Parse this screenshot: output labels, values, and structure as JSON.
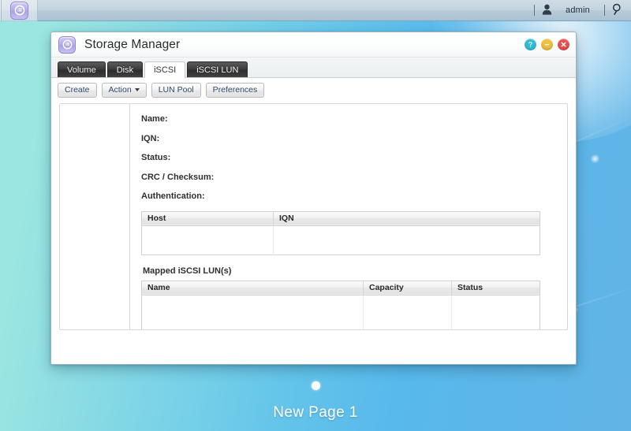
{
  "topbar": {
    "app_icon": "storage-manager-icon",
    "user_icon": "user-icon",
    "user_name": "admin",
    "search_icon": "search-icon"
  },
  "window": {
    "icon": "storage-manager-icon",
    "title": "Storage Manager",
    "controls": {
      "help_label": "?",
      "minimize_label": "–",
      "close_label": "✕"
    },
    "tabs": [
      {
        "label": "Volume",
        "active": false
      },
      {
        "label": "Disk",
        "active": false
      },
      {
        "label": "iSCSI",
        "active": true
      },
      {
        "label": "iSCSI LUN",
        "active": false
      }
    ],
    "toolbar": [
      {
        "label": "Create",
        "has_caret": false
      },
      {
        "label": "Action",
        "has_caret": true
      },
      {
        "label": "LUN Pool",
        "has_caret": false
      },
      {
        "label": "Preferences",
        "has_caret": false
      }
    ],
    "details": {
      "fields": [
        {
          "label": "Name:",
          "value": ""
        },
        {
          "label": "IQN:",
          "value": ""
        },
        {
          "label": "Status:",
          "value": ""
        },
        {
          "label": "CRC / Checksum:",
          "value": ""
        },
        {
          "label": "Authentication:",
          "value": ""
        }
      ],
      "allowed_initiators_table": {
        "columns": [
          "Host",
          "IQN"
        ],
        "rows": []
      },
      "mapped_luns_label": "Mapped iSCSI LUN(s)",
      "mapped_luns_table": {
        "columns": [
          "Name",
          "Capacity",
          "Status"
        ],
        "rows": []
      }
    }
  },
  "desktop": {
    "page_label": "New Page 1",
    "page_dot": "active"
  },
  "colors": {
    "accent_teal": "#33bcd4",
    "accent_yellow": "#f0c040",
    "accent_red": "#e8504e",
    "desktop_left": "#9be6e1",
    "desktop_right": "#62b4e6",
    "tab_active_bg": "#ffffff",
    "tab_inactive_bg": "#3c3c3c"
  }
}
